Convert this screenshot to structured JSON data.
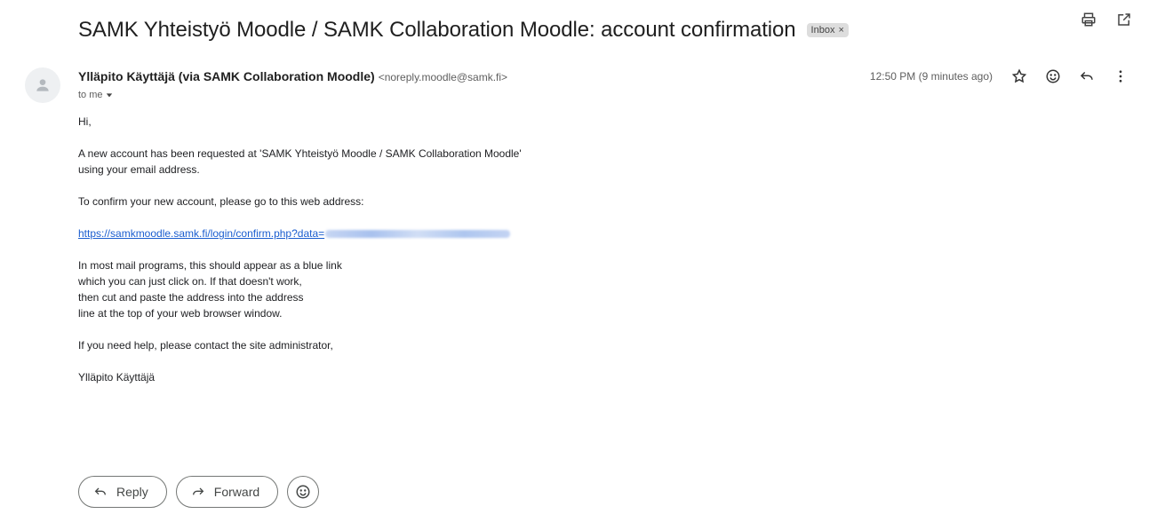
{
  "header": {
    "subject": "SAMK Yhteistyö Moodle / SAMK Collaboration Moodle: account confirmation",
    "label": "Inbox",
    "label_remove": "×"
  },
  "message": {
    "sender_name": "Ylläpito Käyttäjä (via SAMK Collaboration Moodle)",
    "sender_email": "<noreply.moodle@samk.fi>",
    "recipient": "to me",
    "timestamp": "12:50 PM (9 minutes ago)",
    "body": {
      "greeting": "Hi,",
      "para1_line1": "A new account has been requested at 'SAMK Yhteistyö Moodle / SAMK Collaboration Moodle'",
      "para1_line2": "using your email address.",
      "para2": "To confirm your new account, please go to this web address:",
      "link": "https://samkmoodle.samk.fi/login/confirm.php?data=",
      "para3_line1": "In most mail programs, this should appear as a blue link",
      "para3_line2": "which you can just click on. If that doesn't work,",
      "para3_line3": "then cut and paste the address into the address",
      "para3_line4": "line at the top of your web browser window.",
      "para4": "If you need help, please contact the site administrator,",
      "signature": "Ylläpito Käyttäjä"
    }
  },
  "actions": {
    "reply": "Reply",
    "forward": "Forward"
  },
  "icons": {
    "print": "print-icon",
    "open_new_window": "open-in-new-icon",
    "star": "star-icon",
    "emoji": "emoji-icon",
    "reply": "reply-icon",
    "more": "more-vert-icon",
    "avatar": "person-icon",
    "dropdown": "caret-down-icon",
    "forward": "forward-icon"
  }
}
